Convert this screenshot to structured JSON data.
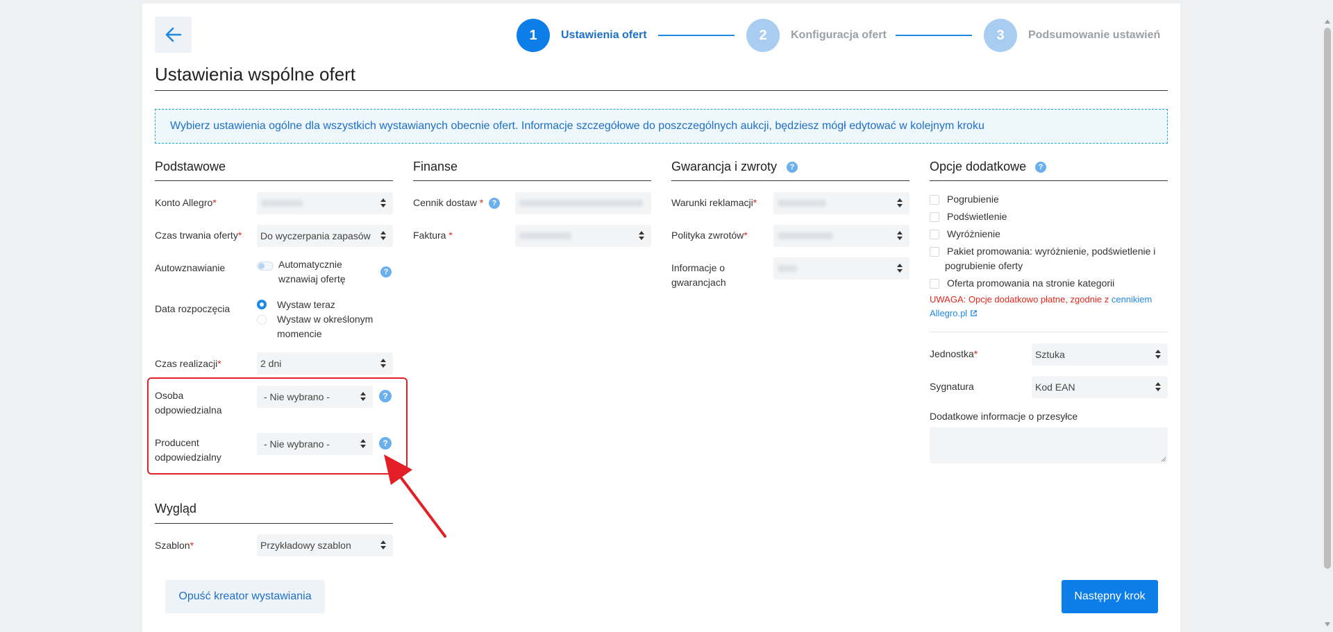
{
  "stepper": [
    {
      "number": "1",
      "label": "Ustawienia ofert",
      "state": "active",
      "color": "#0d7de8"
    },
    {
      "number": "2",
      "label": "Konfiguracja ofert",
      "state": "inactive",
      "color": "#a9cdf1"
    },
    {
      "number": "3",
      "label": "Podsumowanie ustawień",
      "state": "inactive",
      "color": "#a9cdf1"
    }
  ],
  "page_title": "Ustawienia wspólne ofert",
  "info_text": "Wybierz ustawienia ogólne dla wszystkich wystawianych obecnie ofert. Informacje szczegółowe do poszczególnych aukcji, będziesz mógł edytować w kolejnym kroku",
  "podstawowe": {
    "title": "Podstawowe",
    "konto_label": "Konto Allegro",
    "czas_trwania_label": "Czas trwania oferty",
    "czas_trwania_value": "Do wyczerpania zapasów",
    "autownawianie_label": "Autowznawianie",
    "autownawianie_option": "Automatycznie wznawiaj ofertę",
    "data_label": "Data rozpoczęcia",
    "data_option_1": "Wystaw teraz",
    "data_option_2": "Wystaw w określonym momencie",
    "czas_realizacji_label": "Czas realizacji",
    "czas_realizacji_value": "2 dni",
    "osoba_label": "Osoba odpowiedzialna",
    "osoba_value": "- Nie wybrano -",
    "producent_label": "Producent odpowiedzialny",
    "producent_value": "- Nie wybrano -"
  },
  "wyglad": {
    "title": "Wygląd",
    "szablon_label": "Szablon",
    "szablon_value": "Przykładowy szablon"
  },
  "finanse": {
    "title": "Finanse",
    "cennik_label": "Cennik dostaw",
    "faktura_label": "Faktura"
  },
  "gwarancja": {
    "title": "Gwarancja i zwroty",
    "warunki_label": "Warunki reklamacji",
    "polityka_label": "Polityka zwrotów",
    "informacje_label": "Informacje o gwarancjach"
  },
  "opcje": {
    "title": "Opcje dodatkowe",
    "checkboxes": [
      "Pogrubienie",
      "Podświetlenie",
      "Wyróżnienie",
      "Pakiet promowania: wyróżnienie, podświetlenie i pogrubienie oferty",
      "Oferta promowania na stronie kategorii"
    ],
    "warning_text": "UWAGA: Opcje dodatkowo płatne, zgodnie z",
    "warning_link": "cennikiem Allegro.pl",
    "jednostka_label": "Jednostka",
    "jednostka_value": "Sztuka",
    "sygnatura_label": "Sygnatura",
    "sygnatura_value": "Kod EAN",
    "dodatkowe_label": "Dodatkowe informacje o przesyłce"
  },
  "required_mark": "*",
  "help_glyph": "?",
  "buttons": {
    "leave": "Opuść kreator wystawiania",
    "next": "Następny krok"
  }
}
